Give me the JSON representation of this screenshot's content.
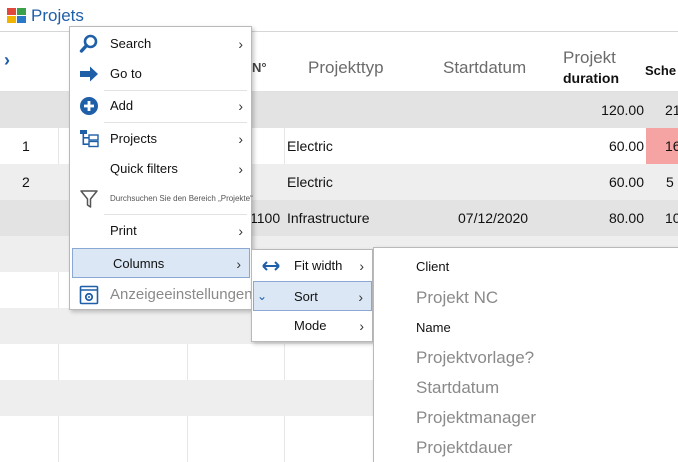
{
  "window": {
    "title": "Projets",
    "colors": {
      "accent": "#1f5fa8",
      "icon_red": "#e2473b",
      "icon_green": "#3aa04a",
      "icon_yellow": "#f0b400",
      "icon_blue": "#2a78c8"
    }
  },
  "grid": {
    "headers": {
      "expand": "›",
      "n": "N°",
      "projekttyp": "Projekttyp",
      "startdatum": "Startdatum",
      "duration_line1": "Projekt",
      "duration_line2": "duration",
      "sche": "Sche"
    },
    "group_row": {
      "duration": "120.00",
      "sche": "21"
    },
    "rows": [
      {
        "index": "1",
        "n": "",
        "typ": "Electric",
        "start": "",
        "duration": "60.00",
        "sche": "16"
      },
      {
        "index": "2",
        "n": "",
        "typ": "Electric",
        "start": "",
        "duration": "60.00",
        "sche": "5"
      },
      {
        "index": "",
        "n": "1100",
        "typ": "Infrastructure",
        "start": "07/12/2020",
        "duration": "80.00",
        "sche": "10"
      }
    ],
    "highlight_color": "#f5a3a3"
  },
  "context_menu": {
    "items": [
      {
        "label": "Search",
        "icon": "search-icon",
        "submenu": true
      },
      {
        "label": "Go to",
        "icon": "arrow-right-icon",
        "submenu": false
      },
      {
        "label": "Add",
        "icon": "plus-circle-icon",
        "submenu": true
      },
      {
        "label": "Projects",
        "icon": "hierarchy-icon",
        "submenu": true
      },
      {
        "label": "Quick filters",
        "icon": "",
        "submenu": true
      },
      {
        "label": "Durchsuchen Sie den Bereich „Projekte“",
        "icon": "filter-icon",
        "submenu": false
      },
      {
        "label": "Print",
        "icon": "",
        "submenu": true
      },
      {
        "label": "Columns",
        "icon": "",
        "submenu": true
      },
      {
        "label": "Anzeigeeinstellungen",
        "icon": "settings-icon",
        "submenu": false
      }
    ]
  },
  "columns_submenu": {
    "items": [
      {
        "label": "Fit width",
        "icon": "fit-width-icon",
        "submenu": true
      },
      {
        "label": "Sort",
        "icon": "sort-icon",
        "submenu": true
      },
      {
        "label": "Mode",
        "icon": "",
        "submenu": true
      }
    ]
  },
  "sort_submenu": {
    "items": [
      {
        "label": "Client",
        "style": "dark"
      },
      {
        "label": "Projekt NC",
        "style": "muted"
      },
      {
        "label": "Name",
        "style": "dark"
      },
      {
        "label": "Projektvorlage?",
        "style": "muted"
      },
      {
        "label": "Startdatum",
        "style": "muted"
      },
      {
        "label": "Projektmanager",
        "style": "muted"
      },
      {
        "label": "Projektdauer",
        "style": "muted"
      }
    ]
  },
  "glyphs": {
    "chevron": "›",
    "chevron_down": "⌄"
  }
}
